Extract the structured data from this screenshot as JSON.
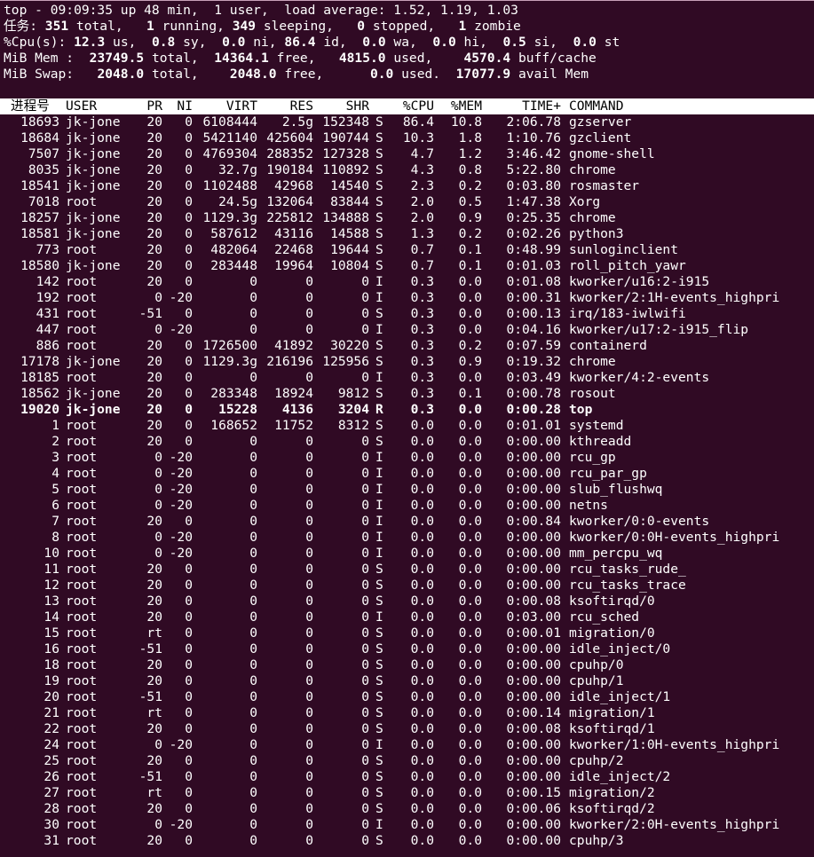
{
  "summary": {
    "top_line": "top - 09:09:35 up 48 min,  1 user,  load average: 1.52, 1.19, 1.03",
    "tasks": {
      "label": "任务:",
      "total": "351",
      "total_label": " total,",
      "running": "1",
      "running_label": " running,",
      "sleeping": "349",
      "sleeping_label": " sleeping,",
      "stopped": "0",
      "stopped_label": " stopped,",
      "zombie": "1",
      "zombie_label": " zombie"
    },
    "cpu": {
      "label": "%Cpu(s):",
      "us": "12.3",
      "us_label": " us,",
      "sy": "0.8",
      "sy_label": " sy,",
      "ni": "0.0",
      "ni_label": " ni,",
      "id": "86.4",
      "id_label": " id,",
      "wa": "0.0",
      "wa_label": " wa,",
      "hi": "0.0",
      "hi_label": " hi,",
      "si": "0.5",
      "si_label": " si,",
      "st": "0.0",
      "st_label": " st"
    },
    "mem": {
      "label": "MiB Mem :",
      "total": "23749.5",
      "total_label": " total,",
      "free": "14364.1",
      "free_label": " free,",
      "used": "4815.0",
      "used_label": " used,",
      "buff": "4570.4",
      "buff_label": " buff/cache"
    },
    "swap": {
      "label": "MiB Swap:",
      "total": "2048.0",
      "total_label": " total,",
      "free": "2048.0",
      "free_label": " free,",
      "used": "0.0",
      "used_label": " used.",
      "avail": "17077.9",
      "avail_label": " avail Mem"
    }
  },
  "columns": {
    "pid": "进程号",
    "user": "USER",
    "pr": "PR",
    "ni": "NI",
    "virt": "VIRT",
    "res": "RES",
    "shr": "SHR",
    "s": "",
    "cpu": "%CPU",
    "mem": "%MEM",
    "time": "TIME+",
    "command": "COMMAND"
  },
  "processes": [
    [
      "18693",
      "jk-jone",
      "20",
      "0",
      "6108444",
      "2.5g",
      "152348",
      "S",
      "86.4",
      "10.8",
      "2:06.78",
      "gzserver"
    ],
    [
      "18684",
      "jk-jone",
      "20",
      "0",
      "5421140",
      "425604",
      "190744",
      "S",
      "10.3",
      "1.8",
      "1:10.76",
      "gzclient"
    ],
    [
      "7507",
      "jk-jone",
      "20",
      "0",
      "4769304",
      "288352",
      "127328",
      "S",
      "4.7",
      "1.2",
      "3:46.42",
      "gnome-shell"
    ],
    [
      "8035",
      "jk-jone",
      "20",
      "0",
      "32.7g",
      "190184",
      "110892",
      "S",
      "4.3",
      "0.8",
      "5:22.80",
      "chrome"
    ],
    [
      "18541",
      "jk-jone",
      "20",
      "0",
      "1102488",
      "42968",
      "14540",
      "S",
      "2.3",
      "0.2",
      "0:03.80",
      "rosmaster"
    ],
    [
      "7018",
      "root",
      "20",
      "0",
      "24.5g",
      "132064",
      "83844",
      "S",
      "2.0",
      "0.5",
      "1:47.38",
      "Xorg"
    ],
    [
      "18257",
      "jk-jone",
      "20",
      "0",
      "1129.3g",
      "225812",
      "134888",
      "S",
      "2.0",
      "0.9",
      "0:25.35",
      "chrome"
    ],
    [
      "18581",
      "jk-jone",
      "20",
      "0",
      "587612",
      "43116",
      "14588",
      "S",
      "1.3",
      "0.2",
      "0:02.26",
      "python3"
    ],
    [
      "773",
      "root",
      "20",
      "0",
      "482064",
      "22468",
      "19644",
      "S",
      "0.7",
      "0.1",
      "0:48.99",
      "sunloginclient"
    ],
    [
      "18580",
      "jk-jone",
      "20",
      "0",
      "283448",
      "19964",
      "10804",
      "S",
      "0.7",
      "0.1",
      "0:01.03",
      "roll_pitch_yawr"
    ],
    [
      "142",
      "root",
      "20",
      "0",
      "0",
      "0",
      "0",
      "I",
      "0.3",
      "0.0",
      "0:01.08",
      "kworker/u16:2-i915"
    ],
    [
      "192",
      "root",
      "0",
      "-20",
      "0",
      "0",
      "0",
      "I",
      "0.3",
      "0.0",
      "0:00.31",
      "kworker/2:1H-events_highpri"
    ],
    [
      "431",
      "root",
      "-51",
      "0",
      "0",
      "0",
      "0",
      "S",
      "0.3",
      "0.0",
      "0:00.13",
      "irq/183-iwlwifi"
    ],
    [
      "447",
      "root",
      "0",
      "-20",
      "0",
      "0",
      "0",
      "I",
      "0.3",
      "0.0",
      "0:04.16",
      "kworker/u17:2-i915_flip"
    ],
    [
      "886",
      "root",
      "20",
      "0",
      "1726500",
      "41892",
      "30220",
      "S",
      "0.3",
      "0.2",
      "0:07.59",
      "containerd"
    ],
    [
      "17178",
      "jk-jone",
      "20",
      "0",
      "1129.3g",
      "216196",
      "125956",
      "S",
      "0.3",
      "0.9",
      "0:19.32",
      "chrome"
    ],
    [
      "18185",
      "root",
      "20",
      "0",
      "0",
      "0",
      "0",
      "I",
      "0.3",
      "0.0",
      "0:03.49",
      "kworker/4:2-events"
    ],
    [
      "18562",
      "jk-jone",
      "20",
      "0",
      "283348",
      "18924",
      "9812",
      "S",
      "0.3",
      "0.1",
      "0:00.78",
      "rosout"
    ],
    [
      "19020",
      "jk-jone",
      "20",
      "0",
      "15228",
      "4136",
      "3204",
      "R",
      "0.3",
      "0.0",
      "0:00.28",
      "top"
    ],
    [
      "1",
      "root",
      "20",
      "0",
      "168652",
      "11752",
      "8312",
      "S",
      "0.0",
      "0.0",
      "0:01.01",
      "systemd"
    ],
    [
      "2",
      "root",
      "20",
      "0",
      "0",
      "0",
      "0",
      "S",
      "0.0",
      "0.0",
      "0:00.00",
      "kthreadd"
    ],
    [
      "3",
      "root",
      "0",
      "-20",
      "0",
      "0",
      "0",
      "I",
      "0.0",
      "0.0",
      "0:00.00",
      "rcu_gp"
    ],
    [
      "4",
      "root",
      "0",
      "-20",
      "0",
      "0",
      "0",
      "I",
      "0.0",
      "0.0",
      "0:00.00",
      "rcu_par_gp"
    ],
    [
      "5",
      "root",
      "0",
      "-20",
      "0",
      "0",
      "0",
      "I",
      "0.0",
      "0.0",
      "0:00.00",
      "slub_flushwq"
    ],
    [
      "6",
      "root",
      "0",
      "-20",
      "0",
      "0",
      "0",
      "I",
      "0.0",
      "0.0",
      "0:00.00",
      "netns"
    ],
    [
      "7",
      "root",
      "20",
      "0",
      "0",
      "0",
      "0",
      "I",
      "0.0",
      "0.0",
      "0:00.84",
      "kworker/0:0-events"
    ],
    [
      "8",
      "root",
      "0",
      "-20",
      "0",
      "0",
      "0",
      "I",
      "0.0",
      "0.0",
      "0:00.00",
      "kworker/0:0H-events_highpri"
    ],
    [
      "10",
      "root",
      "0",
      "-20",
      "0",
      "0",
      "0",
      "I",
      "0.0",
      "0.0",
      "0:00.00",
      "mm_percpu_wq"
    ],
    [
      "11",
      "root",
      "20",
      "0",
      "0",
      "0",
      "0",
      "S",
      "0.0",
      "0.0",
      "0:00.00",
      "rcu_tasks_rude_"
    ],
    [
      "12",
      "root",
      "20",
      "0",
      "0",
      "0",
      "0",
      "S",
      "0.0",
      "0.0",
      "0:00.00",
      "rcu_tasks_trace"
    ],
    [
      "13",
      "root",
      "20",
      "0",
      "0",
      "0",
      "0",
      "S",
      "0.0",
      "0.0",
      "0:00.08",
      "ksoftirqd/0"
    ],
    [
      "14",
      "root",
      "20",
      "0",
      "0",
      "0",
      "0",
      "I",
      "0.0",
      "0.0",
      "0:03.00",
      "rcu_sched"
    ],
    [
      "15",
      "root",
      "rt",
      "0",
      "0",
      "0",
      "0",
      "S",
      "0.0",
      "0.0",
      "0:00.01",
      "migration/0"
    ],
    [
      "16",
      "root",
      "-51",
      "0",
      "0",
      "0",
      "0",
      "S",
      "0.0",
      "0.0",
      "0:00.00",
      "idle_inject/0"
    ],
    [
      "18",
      "root",
      "20",
      "0",
      "0",
      "0",
      "0",
      "S",
      "0.0",
      "0.0",
      "0:00.00",
      "cpuhp/0"
    ],
    [
      "19",
      "root",
      "20",
      "0",
      "0",
      "0",
      "0",
      "S",
      "0.0",
      "0.0",
      "0:00.00",
      "cpuhp/1"
    ],
    [
      "20",
      "root",
      "-51",
      "0",
      "0",
      "0",
      "0",
      "S",
      "0.0",
      "0.0",
      "0:00.00",
      "idle_inject/1"
    ],
    [
      "21",
      "root",
      "rt",
      "0",
      "0",
      "0",
      "0",
      "S",
      "0.0",
      "0.0",
      "0:00.14",
      "migration/1"
    ],
    [
      "22",
      "root",
      "20",
      "0",
      "0",
      "0",
      "0",
      "S",
      "0.0",
      "0.0",
      "0:00.08",
      "ksoftirqd/1"
    ],
    [
      "24",
      "root",
      "0",
      "-20",
      "0",
      "0",
      "0",
      "I",
      "0.0",
      "0.0",
      "0:00.00",
      "kworker/1:0H-events_highpri"
    ],
    [
      "25",
      "root",
      "20",
      "0",
      "0",
      "0",
      "0",
      "S",
      "0.0",
      "0.0",
      "0:00.00",
      "cpuhp/2"
    ],
    [
      "26",
      "root",
      "-51",
      "0",
      "0",
      "0",
      "0",
      "S",
      "0.0",
      "0.0",
      "0:00.00",
      "idle_inject/2"
    ],
    [
      "27",
      "root",
      "rt",
      "0",
      "0",
      "0",
      "0",
      "S",
      "0.0",
      "0.0",
      "0:00.15",
      "migration/2"
    ],
    [
      "28",
      "root",
      "20",
      "0",
      "0",
      "0",
      "0",
      "S",
      "0.0",
      "0.0",
      "0:00.06",
      "ksoftirqd/2"
    ],
    [
      "30",
      "root",
      "0",
      "-20",
      "0",
      "0",
      "0",
      "I",
      "0.0",
      "0.0",
      "0:00.00",
      "kworker/2:0H-events_highpri"
    ],
    [
      "31",
      "root",
      "20",
      "0",
      "0",
      "0",
      "0",
      "S",
      "0.0",
      "0.0",
      "0:00.00",
      "cpuhp/3"
    ]
  ],
  "highlighted_pid": "19020",
  "colors": {
    "background": "#300a24",
    "foreground": "#ffffff",
    "header_bar": "#ffffff",
    "header_text": "#000000"
  }
}
